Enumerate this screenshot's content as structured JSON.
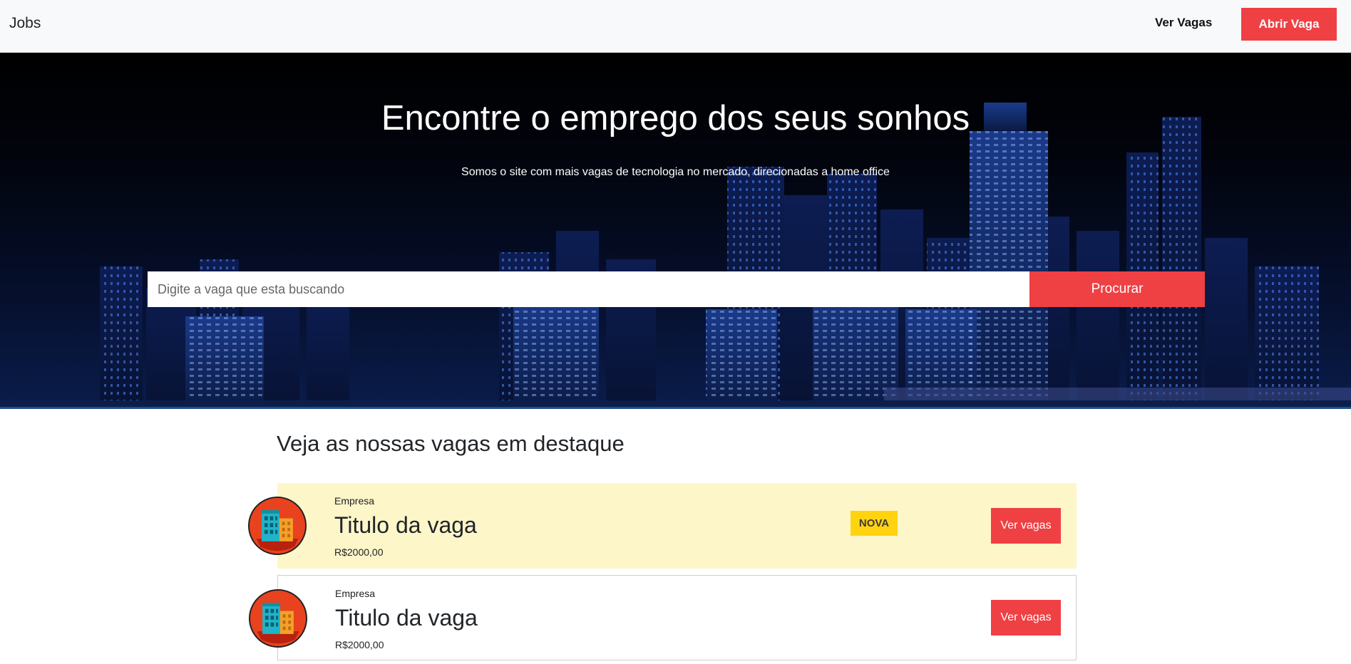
{
  "navbar": {
    "brand": "Jobs",
    "link_label": "Ver Vagas",
    "cta_label": "Abrir Vaga"
  },
  "hero": {
    "title": "Encontre o emprego dos seus sonhos",
    "subtitle": "Somos o site com mais vagas de tecnologia no mercado, direcionadas a home office",
    "search_placeholder": "Digite a vaga que esta buscando",
    "search_button": "Procurar"
  },
  "featured": {
    "title": "Veja as nossas vagas em destaque",
    "jobs": [
      {
        "company": "Empresa",
        "title": "Titulo da vaga",
        "salary": "R$2000,00",
        "badge": "NOVA",
        "button": "Ver vagas",
        "highlighted": true
      },
      {
        "company": "Empresa",
        "title": "Titulo da vaga",
        "salary": "R$2000,00",
        "button": "Ver vagas",
        "highlighted": false
      }
    ]
  },
  "colors": {
    "accent": "#ef4044",
    "highlight_bg": "#fdf6c9",
    "badge_bg": "#ffd310",
    "navbar_bg": "#f8f9fa"
  },
  "icons": {
    "company_logo": "building-icon"
  }
}
